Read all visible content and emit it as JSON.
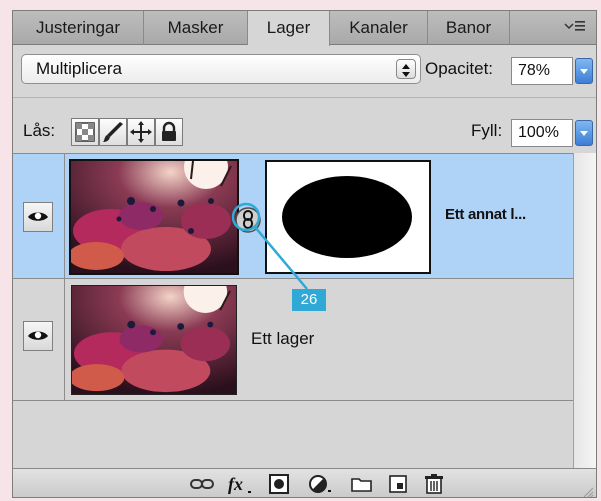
{
  "tabs": [
    {
      "label": "Justeringar",
      "active": false
    },
    {
      "label": "Masker",
      "active": false
    },
    {
      "label": "Lager",
      "active": true
    },
    {
      "label": "Kanaler",
      "active": false
    },
    {
      "label": "Banor",
      "active": false
    }
  ],
  "blend": {
    "mode": "Multiplicera"
  },
  "opacity": {
    "label": "Opacitet:",
    "value": "78%"
  },
  "lock": {
    "label": "Lås:",
    "icons": [
      "lock-transparent-icon",
      "lock-pixels-brush-icon",
      "lock-position-move-icon",
      "lock-all-padlock-icon"
    ]
  },
  "fill": {
    "label": "Fyll:",
    "value": "100%"
  },
  "layers": [
    {
      "name": "Ett annat l...",
      "selected": true,
      "has_mask": true
    },
    {
      "name": "Ett lager",
      "selected": false,
      "has_mask": false
    }
  ],
  "callout": {
    "number": "26"
  },
  "toolbar_icons": [
    "link-layers-icon",
    "fx-icon",
    "add-mask-icon",
    "adjustment-layer-icon",
    "new-group-folder-icon",
    "new-layer-icon",
    "trash-icon"
  ],
  "colors": {
    "selected_row": "#afd2f7",
    "accent": "#30a9d6",
    "panel": "#d6d6d6"
  }
}
